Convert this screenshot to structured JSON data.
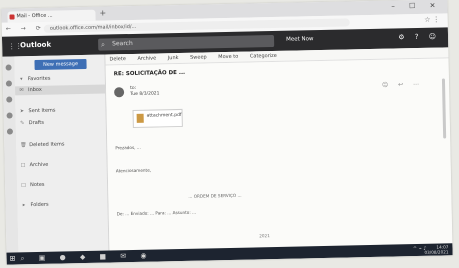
{
  "browser": {
    "tab_title": "Mail - Office ...",
    "new_tab": "+",
    "window_controls": "– ☐ ✕",
    "url": "outlook.office.com/mail/inbox/id/..."
  },
  "header": {
    "apps_icon": "grid-icon",
    "brand": "Outlook",
    "search_placeholder": "Search",
    "meeting_label": "Meet Now",
    "icons": "⚙ ? ☺"
  },
  "sidebar": {
    "new_message": "New message",
    "items": [
      {
        "label": "Favorites",
        "icon": "▾"
      },
      {
        "label": "Inbox",
        "icon": "✉",
        "selected": true
      },
      {
        "label": "Sent Items",
        "icon": "➤"
      },
      {
        "label": "Drafts",
        "icon": "✎"
      },
      {
        "label": "Deleted Items",
        "icon": "🗑"
      },
      {
        "label": "Archive",
        "icon": "□"
      },
      {
        "label": "Notes",
        "icon": "□"
      },
      {
        "label": "Folders",
        "icon": "▸"
      }
    ]
  },
  "commandbar": {
    "items": [
      "Delete",
      "Archive",
      "Junk",
      "Sweep",
      "Move to",
      "Categorize"
    ]
  },
  "message": {
    "subject": "RE: SOLICITAÇÃO DE ...",
    "from_line": "to:",
    "date_line": "Tue 8/3/2021",
    "attachment_name": "attachment.pdf",
    "body": "Prezados, ...",
    "signature": "Atenciosamente,",
    "center_line": "... ORDEM DE SERVIÇO ...",
    "quote": "De: ...  Enviado: ...  Para: ...  Assunto: ...",
    "date_stamp": "2021"
  },
  "taskbar": {
    "start": "⊞",
    "apps": "⌕ ▣ ● ◆ ■ ✉ ◉",
    "tray": "^ ⌁ ♪",
    "time": "14:07",
    "date": "03/08/2021"
  }
}
